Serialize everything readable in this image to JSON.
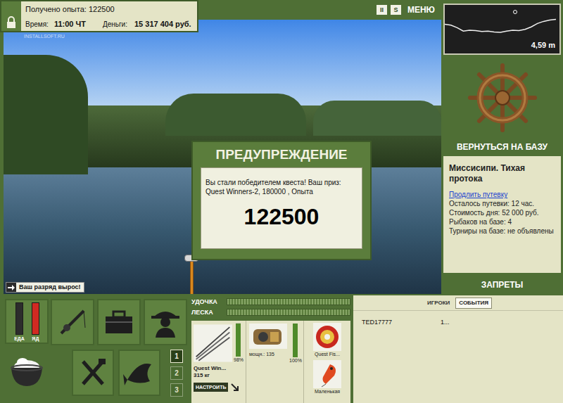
{
  "hud": {
    "experience": "Получено опыта: 122500",
    "time_label": "Время:",
    "time": "11:00 ЧТ",
    "money_label": "Деньги:",
    "money": "15 317 404 руб.",
    "locked": true
  },
  "watermark": "INSTALLSOFT.RU",
  "top_menu": [
    {
      "label": "II",
      "kind": "box"
    },
    {
      "label": "S",
      "kind": "box"
    },
    {
      "label": "МЕНЮ",
      "kind": "text"
    }
  ],
  "depth": {
    "reading": "4,59 m",
    "profile": [
      4.6,
      4.8,
      5.4,
      6.2,
      6.0,
      6.1,
      6.3,
      6.2,
      6.4,
      6.5,
      6.2,
      6.0,
      6.1,
      5.8,
      5.2,
      4.4,
      3.9,
      3.6,
      3.4
    ]
  },
  "base": {
    "return_label": "ВЕРНУТЬСЯ НА БАЗУ",
    "location": "Миссисипи. Тихая протока",
    "extend_link": "Продлить путевку",
    "info": [
      "Осталось путевки: 12 час.",
      "Стоимость дня: 52 000 руб.",
      "Рыбаков на базе: 4",
      "Турниры на базе: не объявлены"
    ],
    "bans_label": "ЗАПРЕТЫ"
  },
  "dialog": {
    "title": "ПРЕДУПРЕЖДЕНИЕ",
    "message": "Вы стали победителем квеста! Ваш приз: Quest Winners-2, 180000 , Опыта",
    "value": "122500"
  },
  "notification": "Ваш разряд вырос!",
  "gauges": [
    {
      "label": "ЕДА",
      "level": 0,
      "color": "#3a3a3a"
    },
    {
      "label": "ЯД",
      "level": 1,
      "color": "#d02a22"
    }
  ],
  "slots": [
    {
      "label": "1",
      "selected": true
    },
    {
      "label": "2",
      "selected": false
    },
    {
      "label": "3",
      "selected": false
    }
  ],
  "tension": [
    {
      "label": "УДОЧКА",
      "level": 0
    },
    {
      "label": "ЛЕСКА",
      "level": 0
    }
  ],
  "tackle": {
    "rod": {
      "name": "Quest Win...",
      "load": "315 кг",
      "wear": "98%",
      "level": 0.98,
      "button": "НАСТРОИТЬ"
    },
    "reel": {
      "power": "мощн.: 135",
      "wear": "100%",
      "level": 1
    },
    "line": {
      "name": "Quest Fis..."
    },
    "lure": {
      "name": "Маленькая"
    }
  },
  "feed_tabs": [
    {
      "label": "ИГРОКИ",
      "selected": false
    },
    {
      "label": "СОБЫТИЯ",
      "selected": true
    }
  ],
  "players": [
    {
      "name": "TED17777",
      "value": "1..."
    }
  ]
}
